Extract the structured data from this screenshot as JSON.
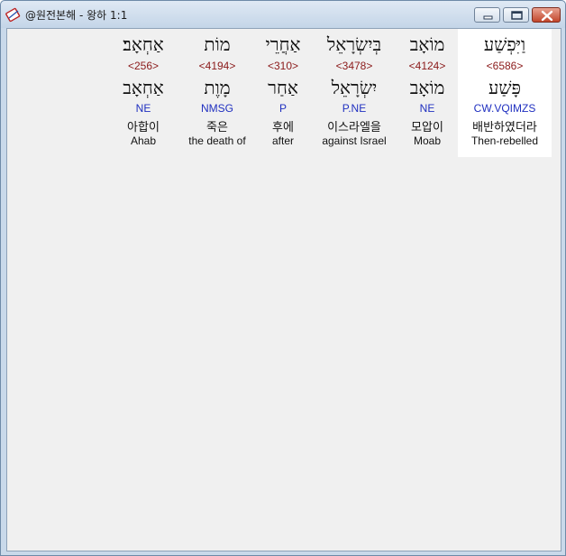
{
  "window": {
    "title": "@원전본해 - 왕하 1:1",
    "icon": "bible-app-icon"
  },
  "words": [
    {
      "hebrew": "וַיִּפְשַׁע",
      "strong": "<6586>",
      "lemma": "פָּשַׁע",
      "morph": "CW.VQIMZS",
      "korean": "배반하였더라",
      "english": "Then-rebelled",
      "selected": true
    },
    {
      "hebrew": "מוֹאָב",
      "strong": "<4124>",
      "lemma": "מוֹאָב",
      "morph": "NE",
      "korean": "모압이",
      "english": "Moab",
      "selected": false
    },
    {
      "hebrew": "בְּיִשְׂרָאֵל",
      "strong": "<3478>",
      "lemma": "יִשְׂרָאֵל",
      "morph": "P.NE",
      "korean": "이스라엘을",
      "english": "against Israel",
      "selected": false
    },
    {
      "hebrew": "אַחֲרֵי",
      "strong": "<310>",
      "lemma": "אַחַר",
      "morph": "P",
      "korean": "후에",
      "english": "after",
      "selected": false
    },
    {
      "hebrew": "מוֹת",
      "strong": "<4194>",
      "lemma": "מָוֶת",
      "morph": "NMSG",
      "korean": "죽은",
      "english": "the death of",
      "selected": false
    },
    {
      "hebrew": "אַחְאָב׃",
      "strong": "<256>",
      "lemma": "אַחְאָב",
      "morph": "NE",
      "korean": "아합이",
      "english": "Ahab",
      "selected": false
    }
  ]
}
